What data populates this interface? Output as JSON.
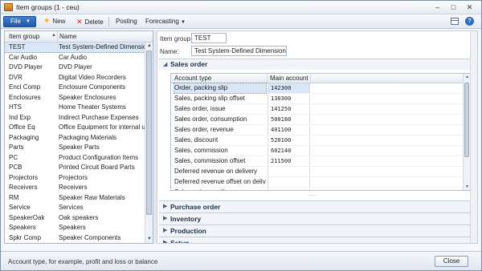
{
  "window": {
    "title": "Item groups (1 - ceu)"
  },
  "toolbar": {
    "file_label": "File",
    "new_label": "New",
    "delete_label": "Delete",
    "posting_label": "Posting",
    "forecasting_label": "Forecasting"
  },
  "list": {
    "columns": [
      "Item group",
      "Name"
    ],
    "rows": [
      {
        "group": "TEST",
        "name": "Test System-Defined Dimension"
      },
      {
        "group": "Car Audio",
        "name": "Car Audio"
      },
      {
        "group": "DVD Player",
        "name": "DVD Player"
      },
      {
        "group": "DVR",
        "name": "Digital Video Recorders"
      },
      {
        "group": "Encl Comp",
        "name": "Enclosure Components"
      },
      {
        "group": "Enclosures",
        "name": "Speaker Enclosures"
      },
      {
        "group": "HTS",
        "name": "Home Theater Systems"
      },
      {
        "group": "Ind Exp",
        "name": "Indirect Purchase Expenses"
      },
      {
        "group": "Office Eq",
        "name": "Office Equipment for internal use"
      },
      {
        "group": "Packaging",
        "name": "Packaging Materials"
      },
      {
        "group": "Parts",
        "name": "Speaker Parts"
      },
      {
        "group": "PC",
        "name": "Product Configuration Items"
      },
      {
        "group": "PCB",
        "name": "Printed Circuit Board Parts"
      },
      {
        "group": "Projectors",
        "name": "Projectors"
      },
      {
        "group": "Receivers",
        "name": "Receivers"
      },
      {
        "group": "RM",
        "name": "Speaker Raw Materials"
      },
      {
        "group": "Service",
        "name": "Services"
      },
      {
        "group": "SpeakerOak",
        "name": "Oak speakers"
      },
      {
        "group": "Speakers",
        "name": "Speakers"
      },
      {
        "group": "Spkr Comp",
        "name": "Speaker Components"
      }
    ]
  },
  "detail": {
    "item_group_label": "Item group:",
    "item_group_value": "TEST",
    "name_label": "Name:",
    "name_value": "Test System-Defined Dimension",
    "sales_order": {
      "title": "Sales order",
      "col_account_type": "Account type",
      "col_main_account": "Main account",
      "rows": [
        {
          "type": "Order, packing slip",
          "account": "142300"
        },
        {
          "type": "Sales, packing slip offset",
          "account": "130300"
        },
        {
          "type": "Sales order, issue",
          "account": "141250"
        },
        {
          "type": "Sales order, consumption",
          "account": "500180"
        },
        {
          "type": "Sales order, revenue",
          "account": "401100"
        },
        {
          "type": "Sales, discount",
          "account": "520100"
        },
        {
          "type": "Sales, commission",
          "account": "602140"
        },
        {
          "type": "Sales, commission offset",
          "account": "211500"
        },
        {
          "type": "Deferred revenue on delivery",
          "account": ""
        },
        {
          "type": "Deferred revenue offset on delivery",
          "account": ""
        },
        {
          "type": "Sales order, credit",
          "account": ""
        }
      ],
      "more": "...."
    },
    "sections": [
      "Purchase order",
      "Inventory",
      "Production",
      "Setup"
    ]
  },
  "status": {
    "text": "Account type, for example, profit and loss or balance",
    "close_label": "Close"
  }
}
